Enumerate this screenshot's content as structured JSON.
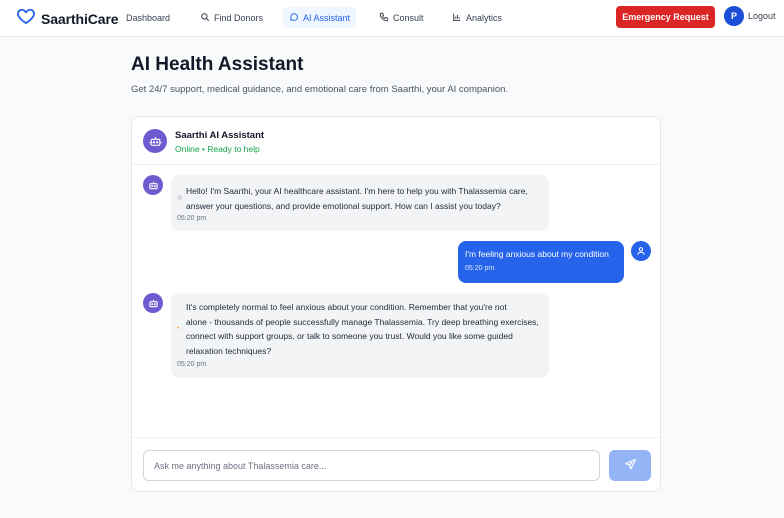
{
  "brand": {
    "name": "SaarthiCare"
  },
  "nav": {
    "dashboard": "Dashboard",
    "find_donors": "Find Donors",
    "ai_assistant": "AI Assistant",
    "consult": "Consult",
    "analytics": "Analytics",
    "emergency": "Emergency Request",
    "avatar_initial": "P",
    "logout": "Logout"
  },
  "page": {
    "title": "AI Health Assistant",
    "subtitle": "Get 24/7 support, medical guidance, and emotional care from Saarthi, your AI companion."
  },
  "chat": {
    "assistant_name": "Saarthi AI Assistant",
    "status": "Online • Ready to help",
    "messages": [
      {
        "sender": "bot",
        "lines": [
          "Hello! I'm Saarthi, your AI healthcare assistant. I'm here to help you with Thalassemia care,",
          "answer your questions, and provide emotional support. How can I assist you today?"
        ],
        "time": "05:20 pm"
      },
      {
        "sender": "user",
        "lines": [
          "I'm feeling anxious about my condition"
        ],
        "time": "05:20 pm"
      },
      {
        "sender": "bot",
        "lines": [
          "It's completely normal to feel anxious about your condition. Remember that you're not",
          "alone - thousands of people successfully manage Thalassemia. Try deep breathing exercises,",
          "connect with support groups, or talk to someone you trust. Would you like some guided",
          "relaxation techniques?"
        ],
        "time": "05:20 pm"
      }
    ],
    "input_placeholder": "Ask me anything about Thalassemia care...",
    "input_value": ""
  },
  "colors": {
    "primary": "#2563eb",
    "emergency": "#dc2626",
    "bot_avatar": "#6d5bd0",
    "online": "#16a34a"
  },
  "icons": {
    "brand": "heart-icon",
    "find_donors": "search-icon",
    "ai_assistant": "chat-bubble-icon",
    "consult": "phone-icon",
    "analytics": "bar-chart-icon",
    "bot": "robot-icon",
    "user": "user-icon",
    "send": "send-icon"
  }
}
